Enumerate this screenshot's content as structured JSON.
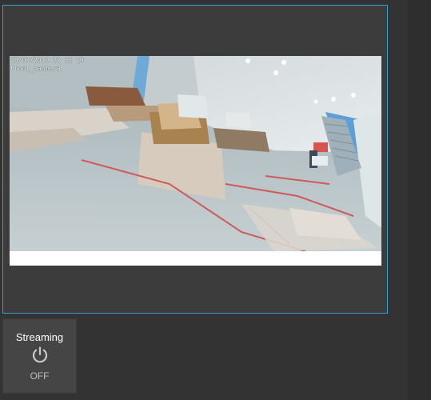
{
  "camera": {
    "timestamp": "25/03/2019 22 16 19",
    "camera_name": "Front_cammera"
  },
  "streaming": {
    "label": "Streaming",
    "state": "OFF",
    "icon": "power-icon"
  },
  "colors": {
    "panel_border": "#3aa0d0",
    "background": "#333333",
    "tile": "#454545"
  }
}
